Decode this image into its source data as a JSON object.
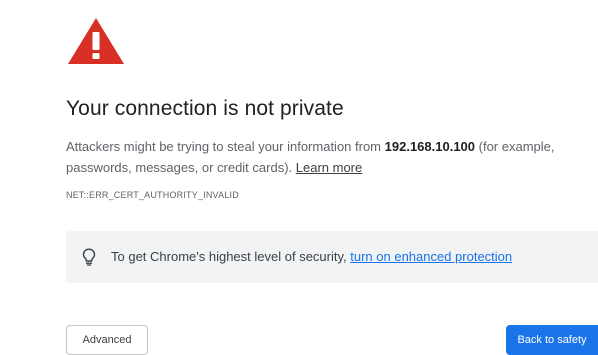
{
  "page": {
    "title": "Your connection is not private"
  },
  "message": {
    "before_host": "Attackers might be trying to steal your information from ",
    "host": "192.168.10.100",
    "after_host": " (for example, passwords, messages, or credit cards). ",
    "learn_more": "Learn more"
  },
  "error_code": "NET::ERR_CERT_AUTHORITY_INVALID",
  "protection": {
    "text": "To get Chrome's highest level of security, ",
    "link": "turn on enhanced protection",
    "icon": "lightbulb-icon"
  },
  "buttons": {
    "advanced": "Advanced",
    "back_to_safety": "Back to safety"
  },
  "icons": {
    "warning": "warning-triangle-icon"
  },
  "colors": {
    "warning_red": "#d93025",
    "primary_blue": "#1a73e8",
    "panel_gray": "#f1f3f4",
    "text_dark": "#202124",
    "text_secondary": "#5f6368"
  }
}
